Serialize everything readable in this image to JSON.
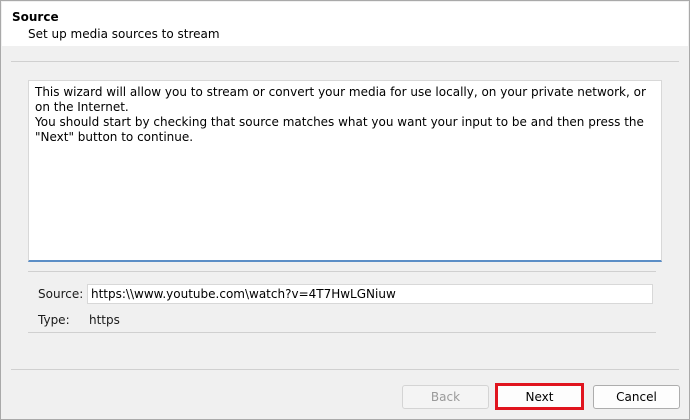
{
  "header": {
    "title": "Source",
    "subtitle": "Set up media sources to stream"
  },
  "description": {
    "line1": "This wizard will allow you to stream or convert your media for use locally, on your private network, or on the Internet.",
    "line2": "You should start by checking that source matches what you want your input to be and then press the \"Next\" button to continue."
  },
  "source": {
    "label": "Source:",
    "value": "https:\\\\www.youtube.com\\watch?v=4T7HwLGNiuw"
  },
  "type": {
    "label": "Type:",
    "value": "https"
  },
  "buttons": {
    "back": "Back",
    "next": "Next",
    "cancel": "Cancel"
  },
  "colors": {
    "highlight": "#e0141e",
    "textbox_focus_border": "#5b8ec6"
  }
}
